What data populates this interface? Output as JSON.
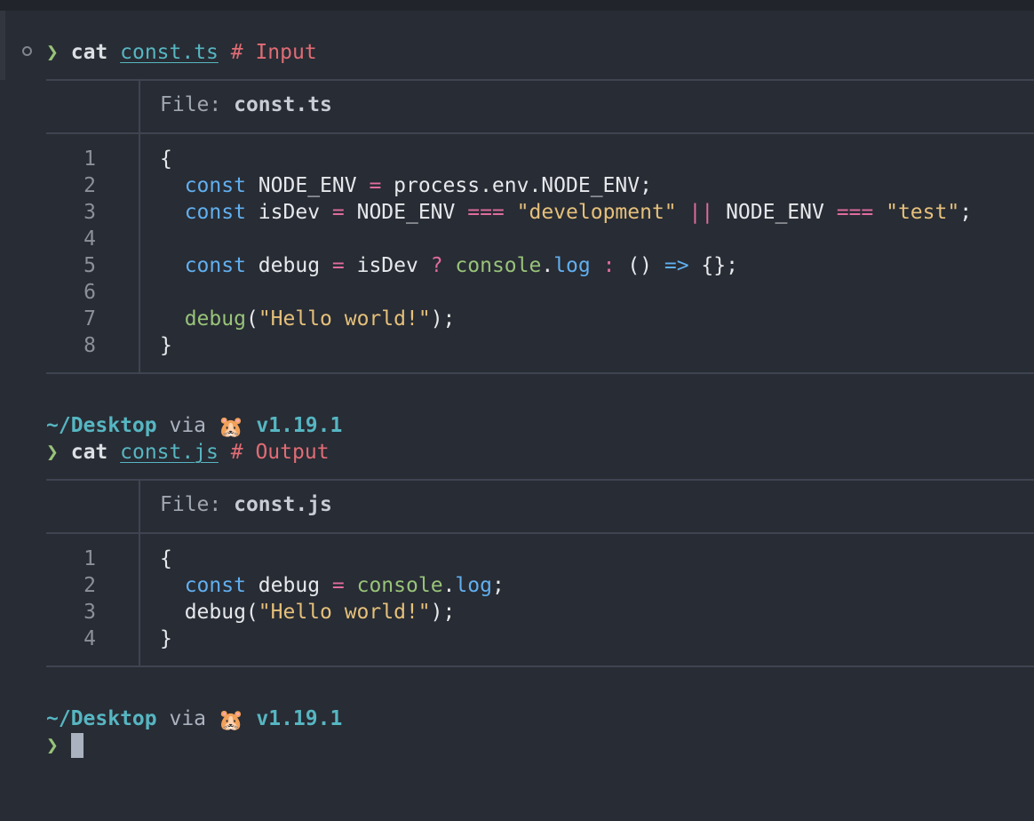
{
  "prompt_symbol": "❯",
  "commands": [
    {
      "cmd": "cat",
      "file": "const.ts",
      "comment": "# Input"
    },
    {
      "cmd": "cat",
      "file": "const.js",
      "comment": "# Output"
    }
  ],
  "prompt_info": {
    "path": "~/Desktop",
    "via": "via",
    "runtime_icon": "🐹",
    "version": "v1.19.1"
  },
  "input_file": {
    "label": "File:",
    "name": "const.ts",
    "line_numbers": [
      "1",
      "2",
      "3",
      "4",
      "5",
      "6",
      "7",
      "8"
    ]
  },
  "output_file": {
    "label": "File:",
    "name": "const.js",
    "line_numbers": [
      "1",
      "2",
      "3",
      "4"
    ]
  },
  "icons": {
    "status": "circle-status-icon",
    "cursor": "terminal-cursor"
  }
}
